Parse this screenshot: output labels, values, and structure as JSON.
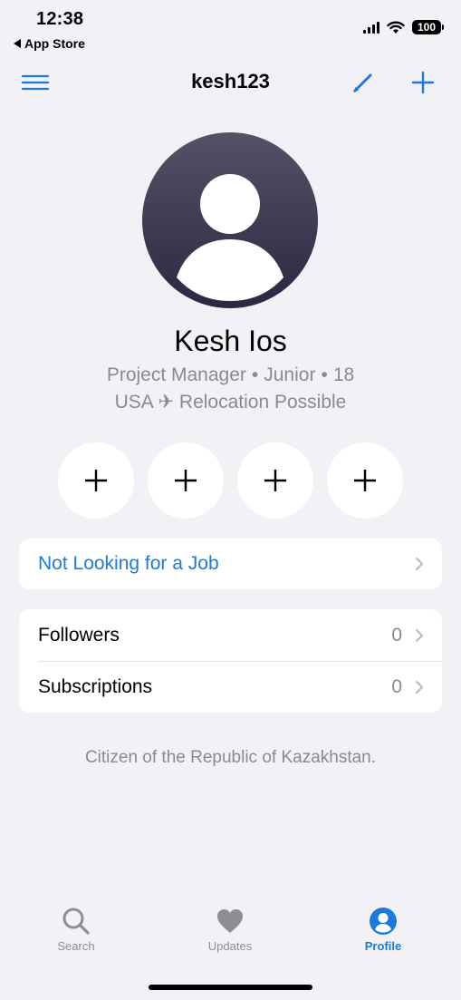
{
  "status_bar": {
    "time": "12:38",
    "back_app": "App Store",
    "battery": "100"
  },
  "nav": {
    "title": "kesh123",
    "menu_icon": "hamburger-menu-icon",
    "edit_icon": "pencil-icon",
    "add_icon": "plus-icon"
  },
  "profile": {
    "name": "Kesh Ios",
    "role": "Project Manager",
    "level": "Junior",
    "age": "18",
    "separator": "•",
    "location_line": "USA ✈ Relocation Possible"
  },
  "quick_actions": [
    {
      "icon": "plus-icon"
    },
    {
      "icon": "plus-icon"
    },
    {
      "icon": "plus-icon"
    },
    {
      "icon": "plus-icon"
    }
  ],
  "job_status": {
    "label": "Not Looking for a Job"
  },
  "stats": [
    {
      "label": "Followers",
      "count": "0"
    },
    {
      "label": "Subscriptions",
      "count": "0"
    }
  ],
  "note": "Citizen of the Republic of Kazakhstan.",
  "tab_bar": {
    "tabs": [
      {
        "label": "Search",
        "icon": "search-icon",
        "active": false
      },
      {
        "label": "Updates",
        "icon": "heart-icon",
        "active": false
      },
      {
        "label": "Profile",
        "icon": "profile-icon",
        "active": true
      }
    ]
  },
  "colors": {
    "accent": "#1a7bd9",
    "background": "#f2f1f6",
    "secondary_text": "#8a8a8f"
  }
}
